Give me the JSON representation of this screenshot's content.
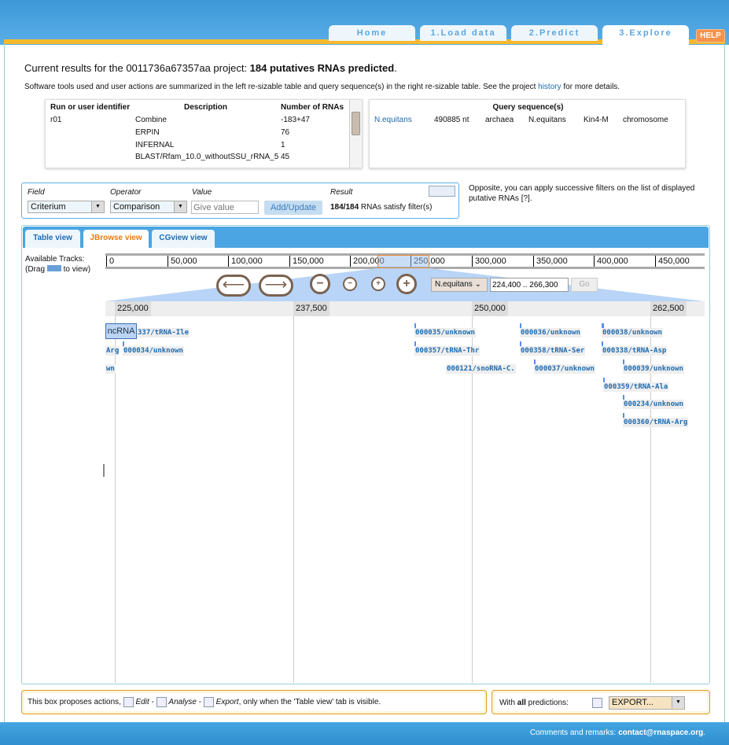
{
  "nav": {
    "tabs": [
      {
        "label": "Home"
      },
      {
        "label": "1.Load data"
      },
      {
        "label": "2.Predict"
      },
      {
        "label": "3.Explore",
        "active": true
      }
    ],
    "help": "HELP"
  },
  "summary": {
    "prefix": "Current results for the 0011736a67357aa project: ",
    "bold": "184 putatives RNAs predicted",
    "suffix": ".",
    "desc_prefix": "Software tools used and user actions are summarized in the left re-sizable table and query sequence(s) in the right re-sizable table. See the project ",
    "history_link": "history",
    "desc_suffix": " for more details."
  },
  "runs_table": {
    "headers": [
      "Run or user identifier",
      "Description",
      "Number of RNAs"
    ],
    "rows": [
      [
        "r01",
        "Combine",
        "-183+47"
      ],
      [
        "",
        "ERPIN",
        "76"
      ],
      [
        "",
        "INFERNAL",
        "1"
      ],
      [
        "",
        "BLAST/Rfam_10.0_withoutSSU_rRNA_5",
        "45"
      ]
    ]
  },
  "query_table": {
    "header": "Query sequence(s)",
    "row": [
      "N.equitans",
      "490885 nt",
      "archaea",
      "N.equitans",
      "Kin4-M",
      "chromosome"
    ]
  },
  "filter": {
    "labels": {
      "field": "Field",
      "operator": "Operator",
      "value": "Value",
      "result": "Result"
    },
    "field": "Criterium",
    "operator": "Comparison",
    "value_placeholder": "Give value",
    "button": "Add/Update",
    "result_bold": "184/184",
    "result_text": " RNAs satisfy filter(s)",
    "hint": "Opposite, you can apply successive filters on the list of displayed putative RNAs [?]."
  },
  "view_tabs": [
    {
      "label": "Table view"
    },
    {
      "label": "JBrowse view",
      "active": true
    },
    {
      "label": "CGview view"
    }
  ],
  "jbrowse": {
    "tracks_label": "Available Tracks:",
    "drag_prefix": "(Drag",
    "drag_suffix": "to view)",
    "overview_ticks": [
      "0",
      "50,000",
      "100,000",
      "150,000",
      "200,000",
      "250,000",
      "300,000",
      "350,000",
      "400,000",
      "450,000"
    ],
    "detail_ticks": [
      "225,000",
      "237,500",
      "250,000",
      "262,500"
    ],
    "refseq": "N.equitans",
    "location": "224,400 .. 266,300",
    "go": "Go",
    "track_label": "ncRNA",
    "features": [
      "337/tRNA-Ile",
      "Arg",
      "000034/unknown",
      "wn",
      "000035/unknown",
      "000357/tRNA-Thr",
      "000121/snoRNA-C.",
      "000036/unknown",
      "000358/tRNA-Ser",
      "000037/unknown",
      "000038/unknown",
      "000338/tRNA-Asp",
      "000039/unknown",
      "000359/tRNA-Ala",
      "000234/unknown",
      "000360/tRNA-Arg"
    ]
  },
  "actions": {
    "text1": "This box proposes actions, ",
    "edit": "Edit",
    "sep": " - ",
    "analyse": "Analyse",
    "export": "Export",
    "text2": ", only when the 'Table view' tab is visible.",
    "all_prefix": "With ",
    "all_bold": "all",
    "all_suffix": " predictions:",
    "export_select": "EXPORT..."
  },
  "footer": {
    "text": "Comments and remarks: ",
    "email": "contact@rnaspace.org",
    "end": "."
  }
}
